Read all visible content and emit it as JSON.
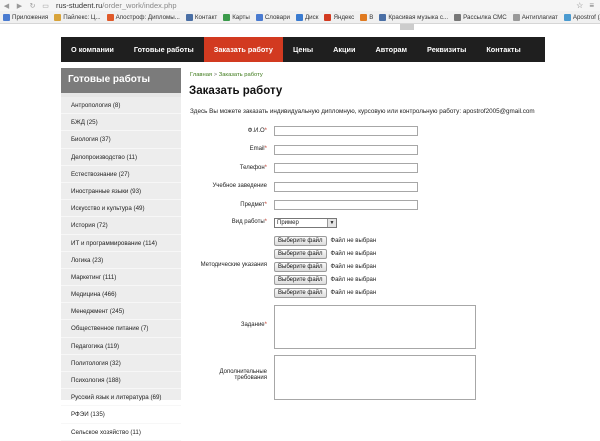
{
  "browser": {
    "url_host": "rus-student.ru",
    "url_path": "/order_work/index.php",
    "bookmarks": [
      {
        "label": "Приложения",
        "color": "#4a7bd0"
      },
      {
        "label": "Пайлекс: Ц...",
        "color": "#d8a33a"
      },
      {
        "label": "Апостроф: Дипломы...",
        "color": "#e05a2a"
      },
      {
        "label": "Контакт",
        "color": "#4a6fa5"
      },
      {
        "label": "Карты",
        "color": "#3a9a4a"
      },
      {
        "label": "Словари",
        "color": "#4a7bd0"
      },
      {
        "label": "Диск",
        "color": "#3a7bd0"
      },
      {
        "label": "Яндекс",
        "color": "#d23a20"
      },
      {
        "label": "В",
        "color": "#e07a20"
      },
      {
        "label": "Красивая музыка с...",
        "color": "#4a6fa5"
      },
      {
        "label": "Рассылка СМС",
        "color": "#777777"
      },
      {
        "label": "Антиплагиат",
        "color": "#999999"
      },
      {
        "label": "Apostrof (Apostro...",
        "color": "#4a9ad0"
      }
    ]
  },
  "nav": {
    "items": [
      "О компании",
      "Готовые работы",
      "Заказать работу",
      "Цены",
      "Акции",
      "Авторам",
      "Реквизиты",
      "Контакты"
    ],
    "active_index": 2,
    "accent_color": "#d23a20"
  },
  "sidebar": {
    "title": "Готовые работы",
    "items": [
      "Антропология (8)",
      "БЖД (25)",
      "Биология (37)",
      "Делопроизводство (11)",
      "Естествознание (27)",
      "Иностранные языки (93)",
      "Искусство и культура (49)",
      "История (72)",
      "ИТ и программирование (114)",
      "Логика (23)",
      "Маркетинг (111)",
      "Медицина (466)",
      "Менеджмент (245)",
      "Общественное питание (7)",
      "Педагогика (119)",
      "Политология (32)",
      "Психология (188)",
      "Русский язык и литература (69)",
      "РФЭИ (135)",
      "Сельское хозяйство (11)"
    ]
  },
  "breadcrumb": {
    "home": "Главная",
    "separator": " > ",
    "current": "Заказать работу"
  },
  "page": {
    "title": "Заказать работу",
    "intro": "Здесь Вы можете заказать индивидуальную дипломную, курсовую или контрольную работу: apostrof2005@gmail.com"
  },
  "form": {
    "fio": "Ф.И.О",
    "email": "Email",
    "phone": "Телефон",
    "school": "Учебное заведение",
    "subject": "Предмет",
    "work_type": "Вид работы",
    "work_type_value": "Пример",
    "guidelines": "Методические указания",
    "file_button": "Выберите файл",
    "file_status": "Файл не выбран",
    "task": "Задание",
    "additional_line1": "Дополнительные",
    "additional_line2": "требования",
    "required_mark": "*"
  }
}
